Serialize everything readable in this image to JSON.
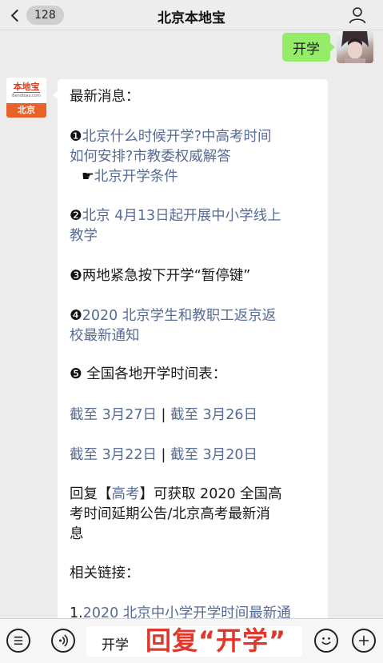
{
  "header": {
    "back_count": "128",
    "title": "北京本地宝"
  },
  "outgoing": {
    "text": "开学"
  },
  "account_avatar": {
    "logo_text": "本地宝",
    "url_text": "Bendibao.com",
    "city": "北京"
  },
  "message": {
    "heading": "最新消息：",
    "item1": {
      "num": "❶",
      "line1": "北京什么时候开学?中高考时间",
      "line2": "如何安排?市教委权威解答"
    },
    "item1_sub": {
      "mark": "☛",
      "text": "北京开学条件"
    },
    "item2": {
      "num": "❷",
      "line1": "北京 4月13日起开展中小学线上",
      "line2": "教学"
    },
    "item3": {
      "num": "❸",
      "text": "两地紧急按下开学“暂停键”"
    },
    "item4": {
      "num": "❹",
      "line1": "2020 北京学生和教职工返京返",
      "line2": "校最新通知"
    },
    "item5": {
      "num": "❺",
      "text": " 全国各地开学时间表："
    },
    "dates_row1": {
      "a": "截至 3月27日",
      "sep": " | ",
      "b": "截至 3月26日"
    },
    "dates_row2": {
      "a": "截至 3月22日",
      "sep": " | ",
      "b": "截至 3月20日"
    },
    "reply": {
      "prefix": "回复【",
      "keyword": "高考",
      "suffix1": "】可获取 2020 全国高",
      "line2": "考时间延期公告/北京高考最新消",
      "line3": "息"
    },
    "related": "相关链接：",
    "related_item": {
      "num": "1.",
      "text": "2020 北京中小学开学时间最新通"
    }
  },
  "input_bar": {
    "input_value": "开学",
    "overlay_text": "回复“开学”"
  }
}
